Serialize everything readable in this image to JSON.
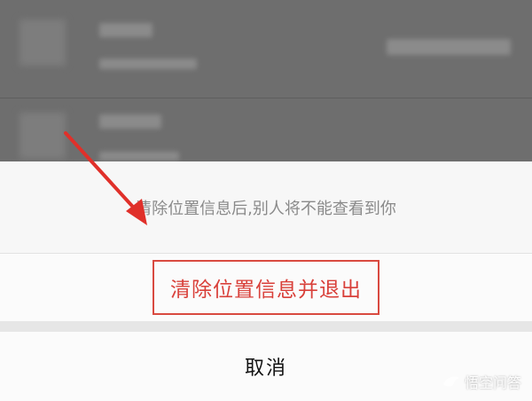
{
  "sheet": {
    "message": "清除位置信息后,别人将不能查看到你",
    "clear_location_label": "清除位置信息并退出",
    "cancel_label": "取消"
  },
  "watermark": {
    "text": "悟空问答",
    "icon": "bird-icon"
  },
  "annotation": {
    "arrow_color": "#e0302a",
    "highlight_color": "#d94a40"
  }
}
